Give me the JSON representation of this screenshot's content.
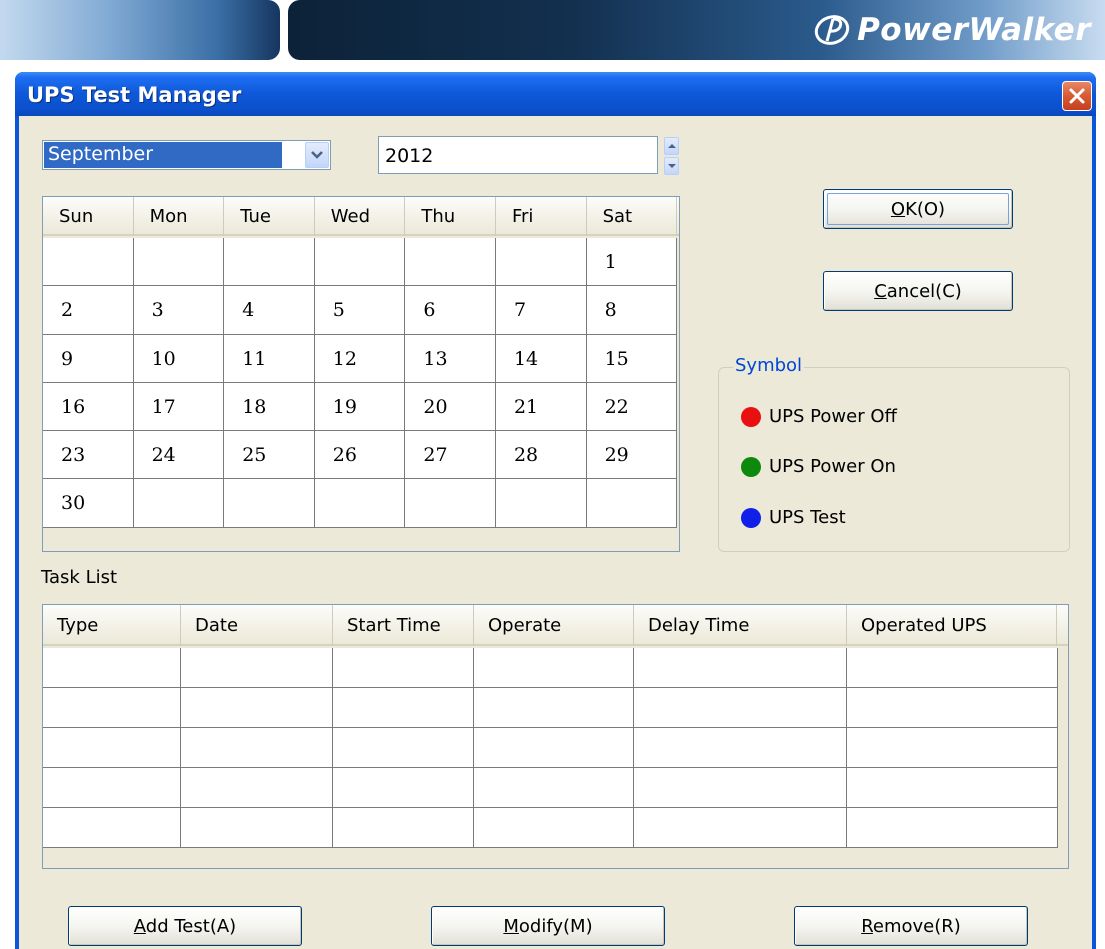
{
  "banner": {
    "brand": "PowerWalker",
    "logo_icon": "powerwalker-logo-icon"
  },
  "window": {
    "title": "UPS Test Manager",
    "close_icon": "close-icon"
  },
  "month_select": {
    "value": "September",
    "dropdown_icon": "chevron-down-icon"
  },
  "year": {
    "value": "2012"
  },
  "calendar": {
    "days_header": [
      "Sun",
      "Mon",
      "Tue",
      "Wed",
      "Thu",
      "Fri",
      "Sat"
    ],
    "weeks": [
      [
        "",
        "",
        "",
        "",
        "",
        "",
        "1"
      ],
      [
        "2",
        "3",
        "4",
        "5",
        "6",
        "7",
        "8"
      ],
      [
        "9",
        "10",
        "11",
        "12",
        "13",
        "14",
        "15"
      ],
      [
        "16",
        "17",
        "18",
        "19",
        "20",
        "21",
        "22"
      ],
      [
        "23",
        "24",
        "25",
        "26",
        "27",
        "28",
        "29"
      ],
      [
        "30",
        "",
        "",
        "",
        "",
        "",
        ""
      ]
    ]
  },
  "buttons": {
    "ok": {
      "mnemonic": "O",
      "rest": "K(O)"
    },
    "cancel": {
      "mnemonic": "C",
      "rest": "ancel(C)"
    },
    "add": {
      "mnemonic": "A",
      "rest": "dd Test(A)"
    },
    "modify": {
      "mnemonic": "M",
      "rest": "odify(M)"
    },
    "remove": {
      "mnemonic": "R",
      "rest": "emove(R)"
    }
  },
  "symbol": {
    "title": "Symbol",
    "items": [
      {
        "label": "UPS Power Off",
        "color": "#e81010"
      },
      {
        "label": "UPS Power On",
        "color": "#0d8a0d"
      },
      {
        "label": "UPS Test",
        "color": "#1020e8"
      }
    ]
  },
  "task_list": {
    "label": "Task List",
    "columns": [
      "Type",
      "Date",
      "Start Time",
      "Operate",
      "Delay Time",
      "Operated UPS"
    ],
    "rows": [
      [
        "",
        "",
        "",
        "",
        "",
        ""
      ],
      [
        "",
        "",
        "",
        "",
        "",
        ""
      ],
      [
        "",
        "",
        "",
        "",
        "",
        ""
      ],
      [
        "",
        "",
        "",
        "",
        "",
        ""
      ],
      [
        "",
        "",
        "",
        "",
        "",
        ""
      ]
    ]
  }
}
